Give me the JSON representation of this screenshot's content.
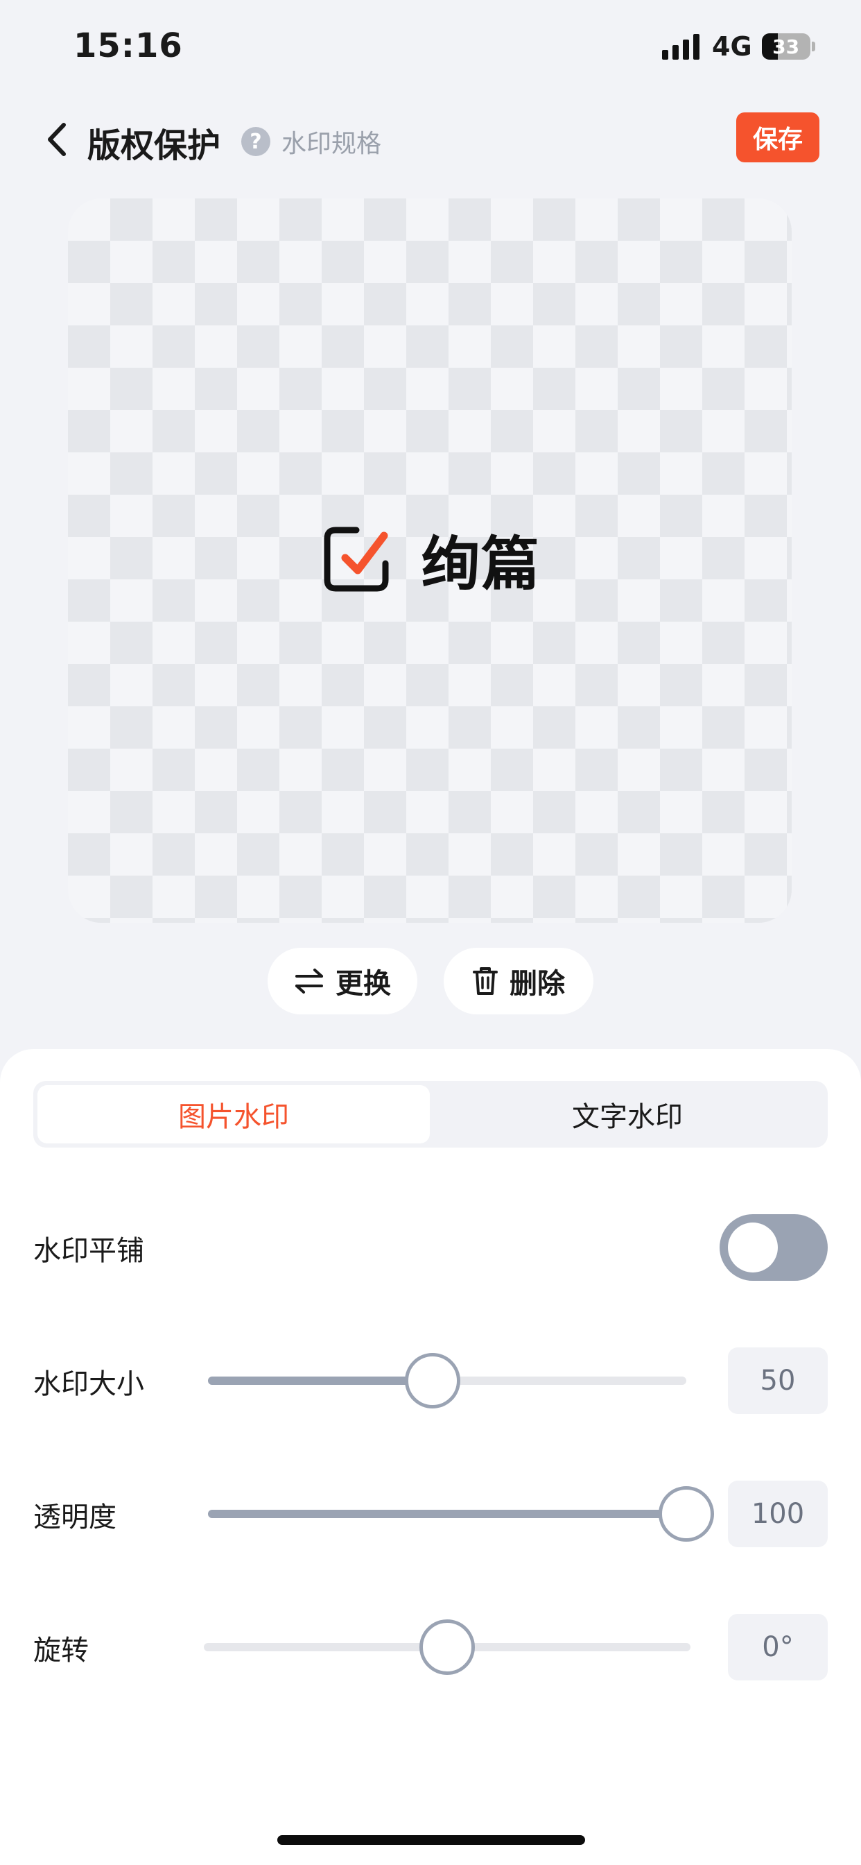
{
  "status_bar": {
    "time": "15:16",
    "network": "4G",
    "battery": "33",
    "battery_level": 0.33
  },
  "nav": {
    "title": "版权保护",
    "help_icon": "question-circle-icon",
    "help_label": "水印规格",
    "save_label": "保存"
  },
  "preview": {
    "watermark_text": "绚篇",
    "accent_color": "#f5532d"
  },
  "actions": {
    "replace_label": "更换",
    "delete_label": "删除"
  },
  "tabs": [
    {
      "label": "图片水印",
      "active": true
    },
    {
      "label": "文字水印",
      "active": false
    }
  ],
  "settings": {
    "tile": {
      "label": "水印平铺",
      "on": false
    },
    "size": {
      "label": "水印大小",
      "value": "50",
      "level": 0.47
    },
    "opacity": {
      "label": "透明度",
      "value": "100",
      "level": 1.0
    },
    "rotation": {
      "label": "旋转",
      "value": "0°",
      "level": 0.5
    }
  },
  "colors": {
    "accent": "#f5532d",
    "control": "#9aa3b3",
    "background": "#f2f3f7"
  }
}
